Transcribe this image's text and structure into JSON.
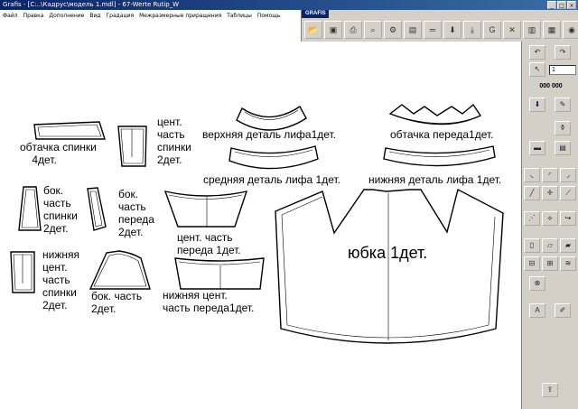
{
  "window": {
    "title": "Grafis - [C:..\\Кадрус\\модель 1.mdl] - 67-Werte Rutip_W"
  },
  "menu": [
    "Файл",
    "Правка",
    "Дополнение",
    "Вид",
    "Градация",
    "Межразмерные приращения",
    "Таблицы",
    "Помощь"
  ],
  "toolbar": {
    "caption": "GRAFIS",
    "buttons": [
      "open-icon",
      "save-icon",
      "print-icon",
      "zoom-icon",
      "f6-icon",
      "layers-icon",
      "measure-icon",
      "arrow-down-icon",
      "import-icon",
      "grading-icon",
      "close-x-icon",
      "f11-icon",
      "f12-icon",
      "pdf-icon"
    ]
  },
  "side": {
    "field_value": "1",
    "counter": "000 000"
  },
  "pieces": {
    "back_facing": "обтачка спинки\n    4дет.",
    "center_back": "цент.\nчасть\nспинки\n2дет.",
    "upper_bodice": "верхняя деталь лифа1дет.",
    "front_facing": "обтачка переда1дет.",
    "middle_bodice": "средняя деталь лифа 1дет.",
    "lower_bodice": "нижняя деталь лифа 1дет.",
    "side_back": "бок.\nчасть\nспинки\n2дет.",
    "side_front": "бок.\nчасть\nпереда\n2дет.",
    "center_front": "цент. часть\nпереда 1дет.",
    "skirt": "юбка 1дет.",
    "lower_center_back": "нижняя\nцент.\nчасть\nспинки\n2дет.",
    "side_part": "бок. часть\n2дет.",
    "lower_center_front": "нижняя цент.\nчасть переда1дет."
  }
}
